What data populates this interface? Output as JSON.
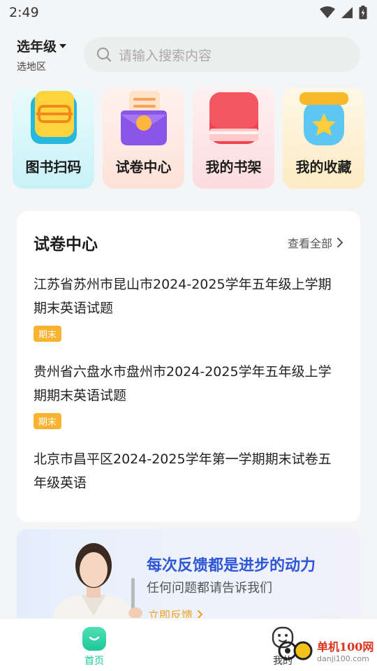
{
  "status_bar": {
    "time": "2:49"
  },
  "header": {
    "grade_label": "选年级",
    "region_label": "选地区",
    "search_placeholder": "请输入搜索内容"
  },
  "quick_actions": [
    {
      "label": "图书扫码",
      "icon": "scan-book-icon"
    },
    {
      "label": "试卷中心",
      "icon": "paper-box-icon"
    },
    {
      "label": "我的书架",
      "icon": "red-book-icon"
    },
    {
      "label": "我的收藏",
      "icon": "star-jar-icon"
    }
  ],
  "paper_center": {
    "title": "试卷中心",
    "view_all": "查看全部",
    "items": [
      {
        "title": "江苏省苏州市昆山市2024-2025学年五年级上学期期末英语试题",
        "tag": "期末"
      },
      {
        "title": "贵州省六盘水市盘州市2024-2025学年五年级上学期期末英语试题",
        "tag": "期末"
      },
      {
        "title": "北京市昌平区2024-2025学年第一学期期末试卷五年级英语",
        "tag": ""
      }
    ]
  },
  "banner": {
    "title": "每次反馈都是进步的动力",
    "subtitle": "任何问题都请告诉我们",
    "cta": "立即反馈"
  },
  "bottom_nav": {
    "home_label": "首页",
    "me_label": "我的"
  },
  "watermark": {
    "name": "单机100网",
    "url": "danji100.com"
  },
  "colors": {
    "accent_green": "#1ec79b",
    "tag_orange": "#f9b230",
    "banner_blue": "#2e57d6",
    "cta_orange": "#f0a11d"
  }
}
